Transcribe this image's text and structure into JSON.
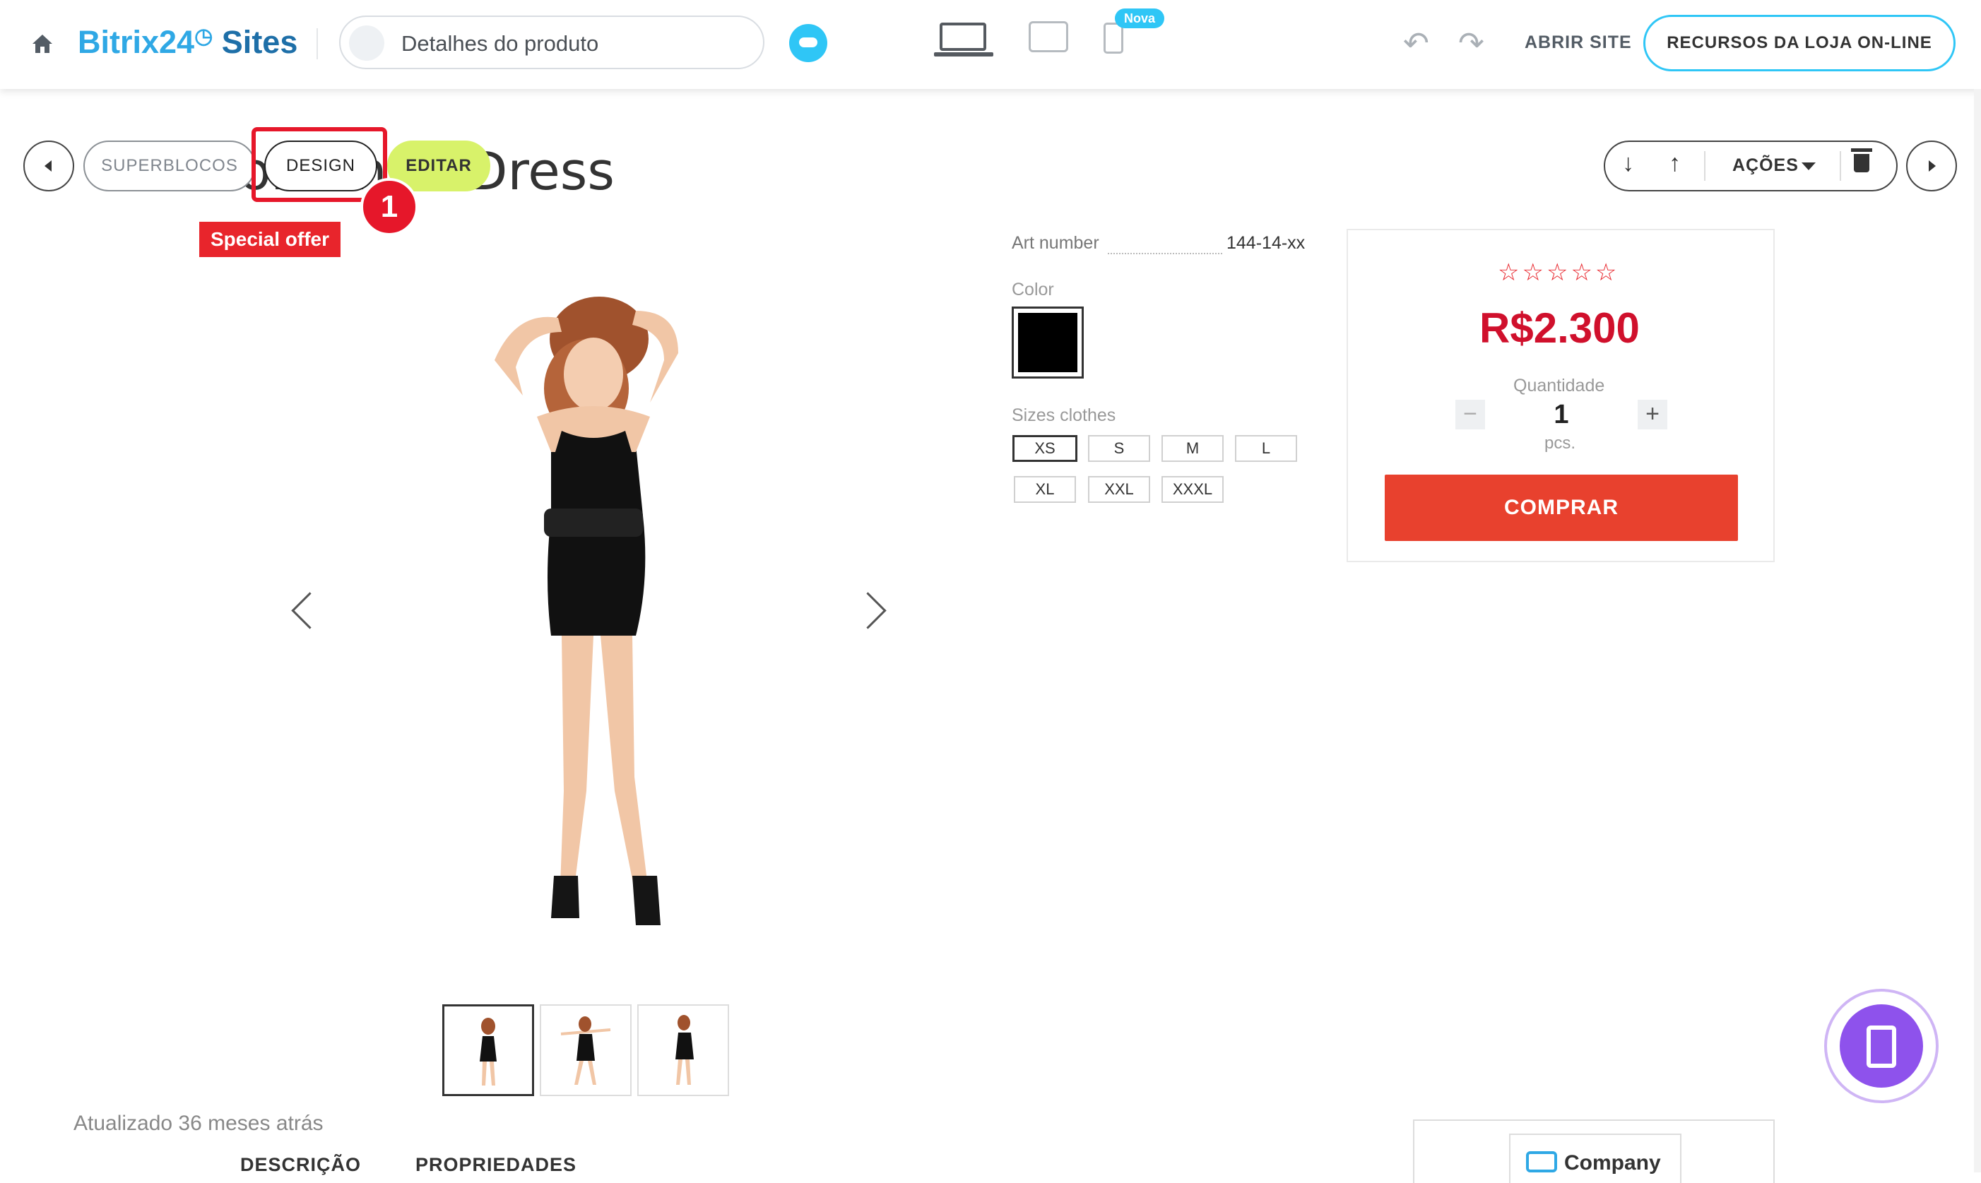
{
  "topbar": {
    "logo_part1": "Bitrix24",
    "logo_part2": "Sites",
    "page_selector": "Detalhes do produto",
    "device_new_badge": "Nova",
    "open_site": "ABRIR SITE",
    "store_resources": "RECURSOS DA LOJA ON-LINE",
    "icons": [
      "home-icon",
      "cloud-icon",
      "desktop-icon",
      "tablet-icon",
      "phone-icon",
      "undo-icon",
      "redo-icon"
    ]
  },
  "block_toolbar": {
    "superblocks": "SUPERBLOCOS",
    "design": "DESIGN",
    "edit": "EDITAR",
    "actions": "AÇÕES",
    "step_marker": "1",
    "colors": {
      "edit_bg": "#d8f26a",
      "highlight": "#e6172a"
    }
  },
  "product": {
    "title": "Romantic Dress",
    "badge": "Special offer",
    "art_label": "Art number",
    "art_value": "144-14-xx",
    "color_label": "Color",
    "color_value": "#000000",
    "sizes_label": "Sizes clothes",
    "sizes": [
      "XS",
      "S",
      "M",
      "L",
      "XL",
      "XXL",
      "XXXL"
    ],
    "selected_size": "XS",
    "updated": "Atualizado 36 meses atrás",
    "tabs": [
      "DESCRIÇÃO",
      "PROPRIEDADES"
    ]
  },
  "buy": {
    "rating_stars": "☆☆☆☆☆",
    "rating_value": 0,
    "price": "R$2.300",
    "qty_label": "Quantidade",
    "qty_value": "1",
    "qty_unit": "pcs.",
    "buy_label": "COMPRAR",
    "colors": {
      "price": "#d0102c",
      "button": "#e8412e"
    }
  },
  "company": {
    "text": "Company"
  }
}
